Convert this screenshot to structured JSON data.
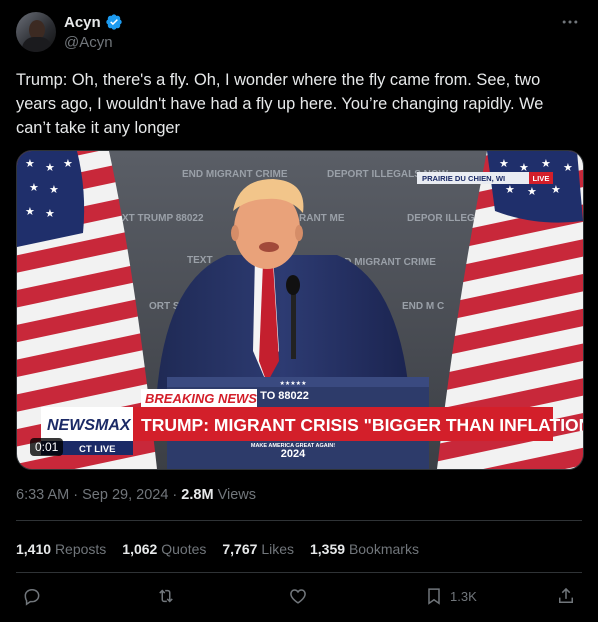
{
  "author": {
    "display_name": "Acyn",
    "handle": "@Acyn",
    "verified": true,
    "avatar_icon": "profile-photo"
  },
  "tweet": {
    "text": "Trump: Oh, there's a fly. Oh, I wonder where the fly came from. See, two years ago, I wouldn't have had a fly up here. You’re changing rapidly. We can’t take it any longer"
  },
  "media": {
    "duration": "0:01",
    "chyron": {
      "location_tag": "PRAIRIE DU CHIEN, WI",
      "live_tag": "LIVE",
      "breaking_label": "BREAKING NEWS",
      "headline": "TRUMP: MIGRANT CRISIS \"BIGGER THAN INFLATION\"",
      "network": "NEWSMAX",
      "time_live": "CT  LIVE",
      "podium_top": "SCONSIN TO 88022",
      "podium_slogan": "MAKE AMERICA GREAT AGAIN!",
      "podium_year": "2024"
    },
    "backdrop_signs": [
      "END MIGRANT CRIME",
      "DEPORT ILLEGALS NOW",
      "XT TRUMP 88022",
      "RANT ME",
      "DEPOR ILLEGALS",
      "TEXT",
      "ND MIGRANT CRIME",
      "ORT S N",
      "END M C"
    ]
  },
  "meta": {
    "time": "6:33 AM",
    "separator": "·",
    "date": "Sep 29, 2024",
    "views_count": "2.8M",
    "views_label": "Views"
  },
  "stats": {
    "reposts_count": "1,410",
    "reposts_label": "Reposts",
    "quotes_count": "1,062",
    "quotes_label": "Quotes",
    "likes_count": "7,767",
    "likes_label": "Likes",
    "bookmarks_count": "1,359",
    "bookmarks_label": "Bookmarks"
  },
  "actions": {
    "bookmark_count": "1.3K"
  },
  "colors": {
    "background": "#000000",
    "text": "#e7e9ea",
    "secondary": "#71767b",
    "verified": "#1d9bf0",
    "divider": "#2f3336",
    "newsmax_red": "#d31f2a"
  }
}
